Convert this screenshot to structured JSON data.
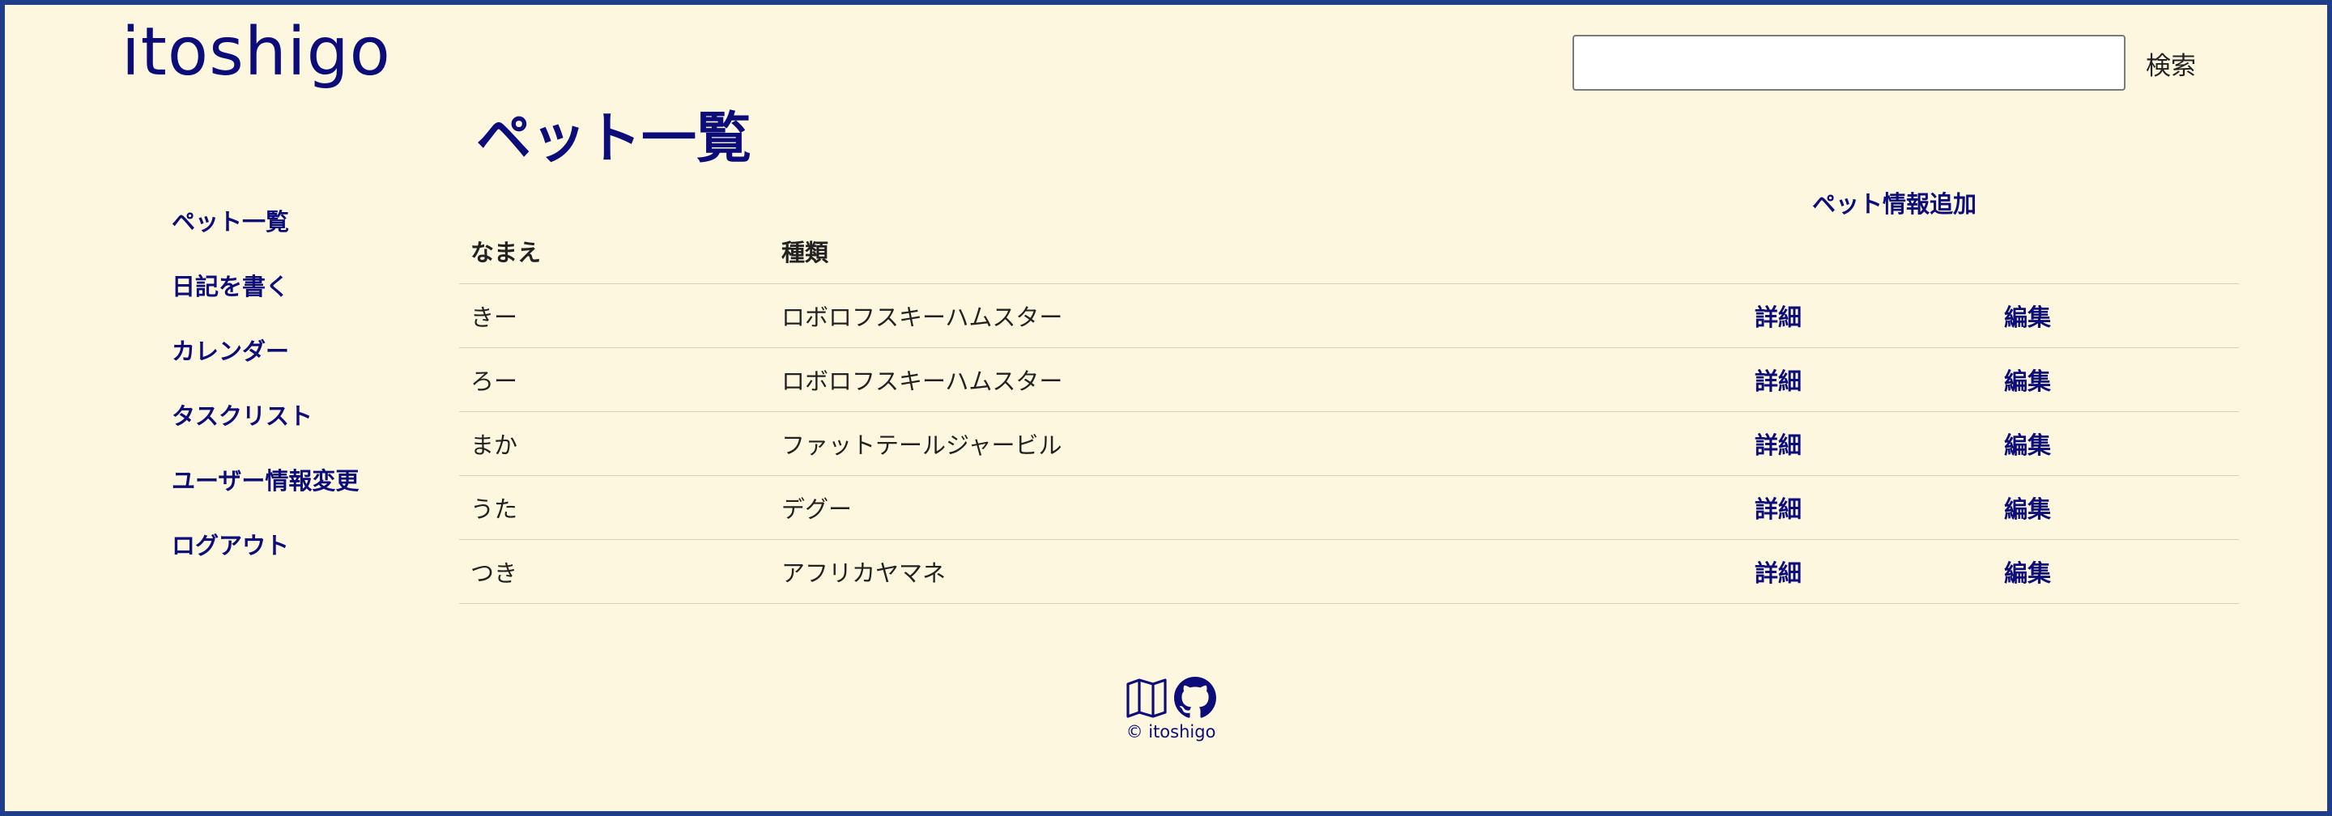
{
  "header": {
    "logo": "itoshigo",
    "search_placeholder": "",
    "search_button": "検索"
  },
  "page_title": "ペット一覧",
  "sidebar": {
    "items": [
      {
        "label": "ペット一覧"
      },
      {
        "label": "日記を書く"
      },
      {
        "label": "カレンダー"
      },
      {
        "label": "タスクリスト"
      },
      {
        "label": "ユーザー情報変更"
      },
      {
        "label": "ログアウト"
      }
    ]
  },
  "add_pet_link": "ペット情報追加",
  "table": {
    "headers": [
      "なまえ",
      "種類"
    ],
    "rows": [
      {
        "name": "きー",
        "type": "ロボロフスキーハムスター",
        "detail": "詳細",
        "edit": "編集"
      },
      {
        "name": "ろー",
        "type": "ロボロフスキーハムスター",
        "detail": "詳細",
        "edit": "編集"
      },
      {
        "name": "まか",
        "type": "ファットテールジャービル",
        "detail": "詳細",
        "edit": "編集"
      },
      {
        "name": "うた",
        "type": "デグー",
        "detail": "詳細",
        "edit": "編集"
      },
      {
        "name": "つき",
        "type": "アフリカヤマネ",
        "detail": "詳細",
        "edit": "編集"
      }
    ]
  },
  "footer": {
    "icons": [
      "map-icon",
      "github-icon"
    ],
    "copyright": "© itoshigo"
  },
  "colors": {
    "background": "#fdf7df",
    "accent": "#0d0d7a",
    "border": "#1f3e8a"
  }
}
